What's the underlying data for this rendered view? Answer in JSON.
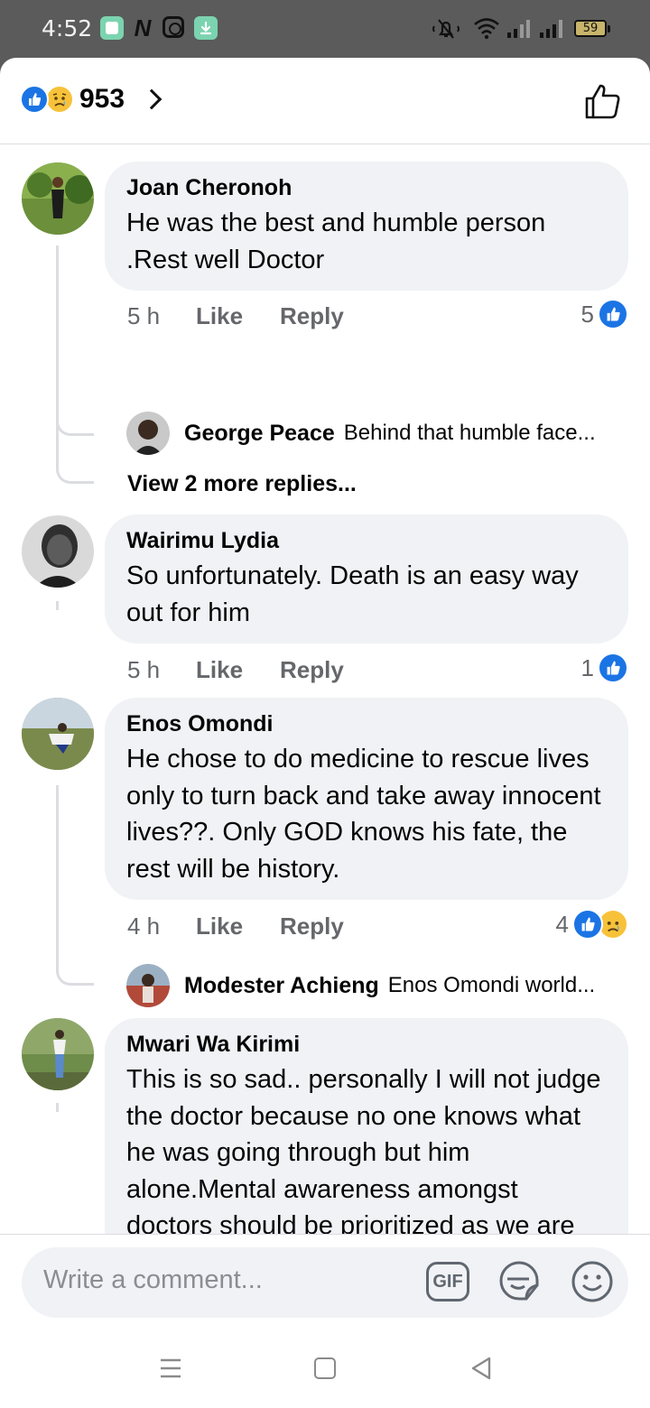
{
  "status_bar": {
    "time": "4:52",
    "battery": "59",
    "icons": [
      "notes-app-icon",
      "n-app-icon",
      "instagram-icon",
      "download-icon",
      "mute-icon",
      "wifi-icon",
      "signal-icon",
      "signal-icon",
      "battery-icon"
    ]
  },
  "header": {
    "reaction_count": "953",
    "reaction_icons": [
      "like-reaction-icon",
      "sad-reaction-icon"
    ],
    "right_icon": "thumbs-up-outline-icon"
  },
  "comments": [
    {
      "author": "Joan Cheronoh",
      "text": "He was the best and humble person .Rest well Doctor",
      "time": "5 h",
      "like_label": "Like",
      "reply_label": "Reply",
      "reaction_count": "5",
      "reply_preview": {
        "author": "George Peace",
        "text": "Behind that humble face..."
      },
      "view_more": "View 2 more replies..."
    },
    {
      "author": "Wairimu Lydia",
      "text": "So unfortunately. Death is an easy way out for him",
      "time": "5 h",
      "like_label": "Like",
      "reply_label": "Reply",
      "reaction_count": "1"
    },
    {
      "author": "Enos Omondi",
      "text": "He chose to do medicine to rescue lives only to turn back and take away innocent lives??. Only GOD knows his fate, the rest will be history.",
      "time": "4 h",
      "like_label": "Like",
      "reply_label": "Reply",
      "reaction_count": "4",
      "reply_preview": {
        "author": "Modester Achieng",
        "text": "Enos Omondi world..."
      }
    },
    {
      "author": "Mwari Wa Kirimi",
      "text": "This is so sad.. personally I will not judge the doctor because no one knows what he was going through but him alone.Mental awareness amongst doctors should be prioritized as we are witnessing alot"
    }
  ],
  "composer": {
    "placeholder": "Write a comment...",
    "gif_label": "GIF"
  },
  "nav": {
    "icons": [
      "menu-icon",
      "home-icon",
      "back-icon"
    ]
  },
  "colors": {
    "facebook_blue": "#1b74e4",
    "sad_yellow": "#f7c23a",
    "bubble_gray": "#f0f2f5",
    "meta_gray": "#65676b",
    "status_bar_bg": "#5b5b5b"
  }
}
